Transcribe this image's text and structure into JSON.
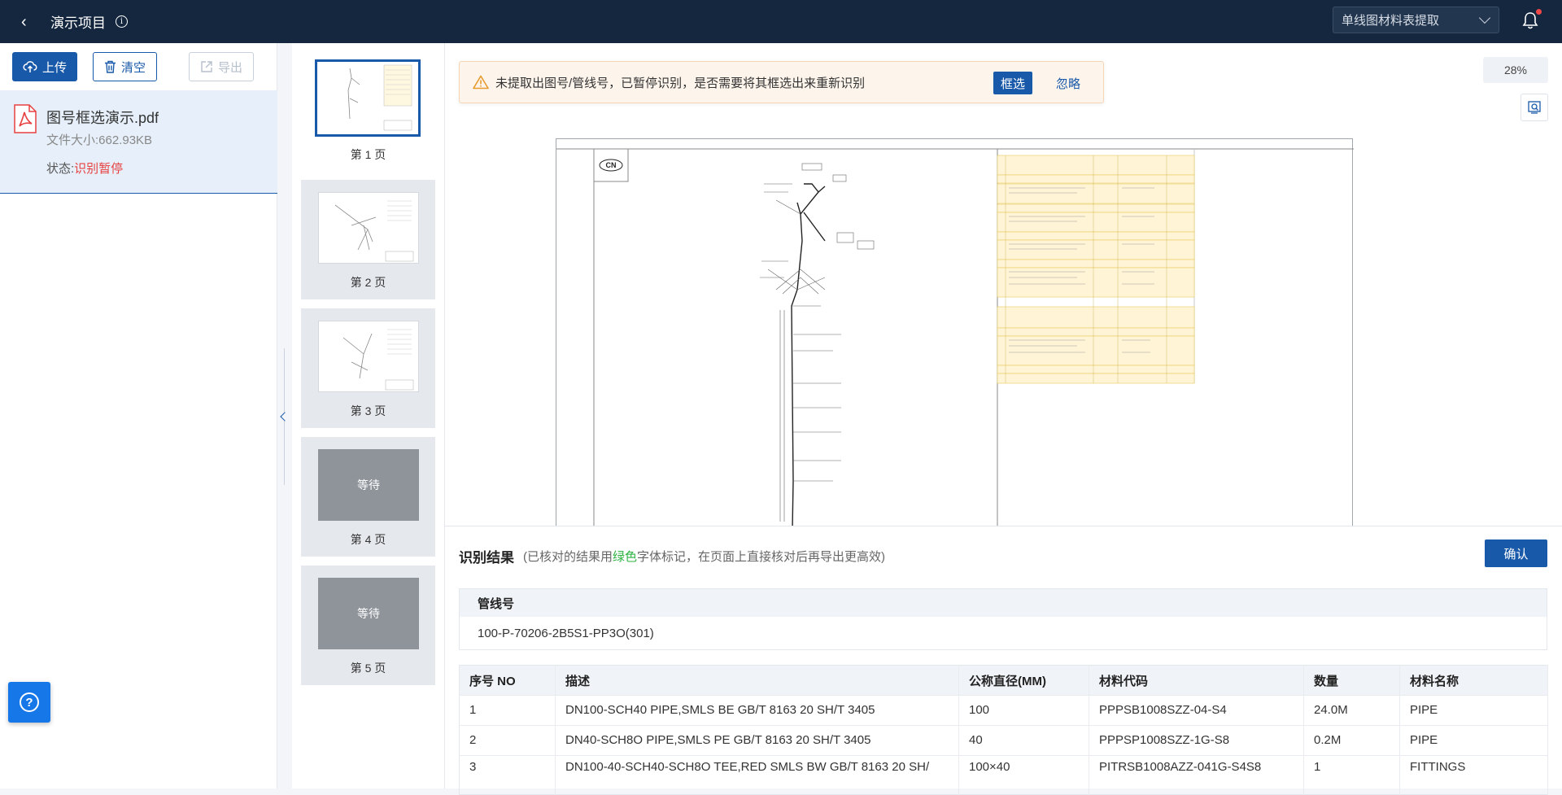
{
  "header": {
    "title": "演示项目",
    "mode_select": "单线图材料表提取"
  },
  "toolbar": {
    "upload_label": "上传",
    "clear_label": "清空",
    "export_label": "导出"
  },
  "file": {
    "name": "图号框选演示.pdf",
    "size_label": "文件大小:662.93KB",
    "status_prefix": "状态:",
    "status_value": "识别暂停"
  },
  "thumbnails": [
    {
      "caption": "第 1 页",
      "state": "active"
    },
    {
      "caption": "第 2 页",
      "state": "done"
    },
    {
      "caption": "第 3 页",
      "state": "done"
    },
    {
      "caption": "第 4 页",
      "state": "waiting",
      "overlay": "等待"
    },
    {
      "caption": "第 5 页",
      "state": "waiting",
      "overlay": "等待"
    }
  ],
  "alert": {
    "message": "未提取出图号/管线号，已暂停识别，是否需要将其框选出来重新识别",
    "pick_label": "框选",
    "ignore_label": "忽略"
  },
  "viewer": {
    "zoom": "28%",
    "drawing_tag": "CN"
  },
  "results": {
    "title": "识别结果",
    "note_before": "(已核对的结果用",
    "note_green": "绿色",
    "note_after": "字体标记，在页面上直接核对后再导出更高效)",
    "confirm_label": "确认",
    "pipeline_header": "管线号",
    "pipeline_value": "100-P-70206-2B5S1-PP3O(301)",
    "columns": [
      "序号 NO",
      "描述",
      "公称直径(MM)",
      "材料代码",
      "数量",
      "材料名称"
    ],
    "rows": [
      [
        "1",
        "DN100-SCH40 PIPE,SMLS BE GB/T 8163 20 SH/T 3405",
        "100",
        "PPPSB1008SZZ-04-S4",
        "24.0M",
        "PIPE"
      ],
      [
        "2",
        "DN40-SCH8O PIPE,SMLS PE GB/T 8163 20 SH/T 3405",
        "40",
        "PPPSP1008SZZ-1G-S8",
        "0.2M",
        "PIPE"
      ],
      [
        "3",
        "DN100-40-SCH40-SCH8O TEE,RED SMLS BW GB/T 8163 20 SH/",
        "100×40",
        "PITRSB1008AZZ-041G-S4S8",
        "1",
        "FITTINGS"
      ]
    ]
  },
  "colors": {
    "topbar": "#14273f",
    "primary": "#1959a9",
    "danger": "#e74040",
    "success": "#2fb344",
    "warning_bg": "#fdf4ec"
  }
}
